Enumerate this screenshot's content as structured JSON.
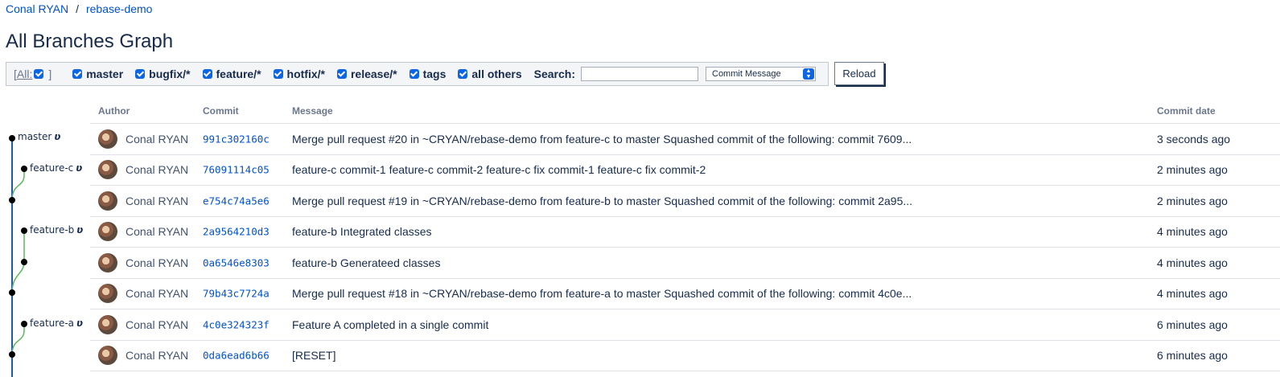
{
  "breadcrumb": {
    "owner": "Conal RYAN",
    "separator": "/",
    "repo": "rebase-demo"
  },
  "page_title": "All Branches Graph",
  "filters": {
    "all_label": "All:",
    "all_open": "[",
    "all_close": "]",
    "items": [
      {
        "label": "master",
        "checked": true
      },
      {
        "label": "bugfix/*",
        "checked": true
      },
      {
        "label": "feature/*",
        "checked": true
      },
      {
        "label": "hotfix/*",
        "checked": true
      },
      {
        "label": "release/*",
        "checked": true
      },
      {
        "label": "tags",
        "checked": true
      },
      {
        "label": "all others",
        "checked": true
      }
    ],
    "search_label": "Search:",
    "search_value": "",
    "search_mode": "Commit Message",
    "reload_label": "Reload"
  },
  "table": {
    "headers": {
      "author": "Author",
      "commit": "Commit",
      "message": "Message",
      "date": "Commit date"
    },
    "rows": [
      {
        "author": "Conal RYAN",
        "commit": "991c302160c",
        "message": "Merge pull request #20 in ~CRYAN/rebase-demo from feature-c to master Squashed commit of the following: commit 7609...",
        "date": "3 seconds ago"
      },
      {
        "author": "Conal RYAN",
        "commit": "76091114c05",
        "message": "feature-c commit-1 feature-c commit-2 feature-c fix commit-1 feature-c fix commit-2",
        "date": "2 minutes ago"
      },
      {
        "author": "Conal RYAN",
        "commit": "e754c74a5e6",
        "message": "Merge pull request #19 in ~CRYAN/rebase-demo from feature-b to master Squashed commit of the following: commit 2a95...",
        "date": "2 minutes ago"
      },
      {
        "author": "Conal RYAN",
        "commit": "2a9564210d3",
        "message": "feature-b Integrated classes",
        "date": "4 minutes ago"
      },
      {
        "author": "Conal RYAN",
        "commit": "0a6546e8303",
        "message": "feature-b Generateed classes",
        "date": "4 minutes ago"
      },
      {
        "author": "Conal RYAN",
        "commit": "79b43c7724a",
        "message": "Merge pull request #18 in ~CRYAN/rebase-demo from feature-a to master Squashed commit of the following: commit 4c0e...",
        "date": "4 minutes ago"
      },
      {
        "author": "Conal RYAN",
        "commit": "4c0e324323f",
        "message": "Feature A completed in a single commit",
        "date": "6 minutes ago"
      },
      {
        "author": "Conal RYAN",
        "commit": "0da6ead6b66",
        "message": "[RESET]",
        "date": "6 minutes ago"
      }
    ]
  },
  "graph": {
    "branch_icon": "branch-icon",
    "labels": [
      {
        "text": "master"
      },
      {
        "text": "feature-c"
      },
      {
        "text": "feature-b"
      },
      {
        "text": "feature-a"
      }
    ],
    "colors": {
      "master_line": "#1f5aa6",
      "feature_line": "#5cb85c",
      "node": "#000000"
    }
  }
}
